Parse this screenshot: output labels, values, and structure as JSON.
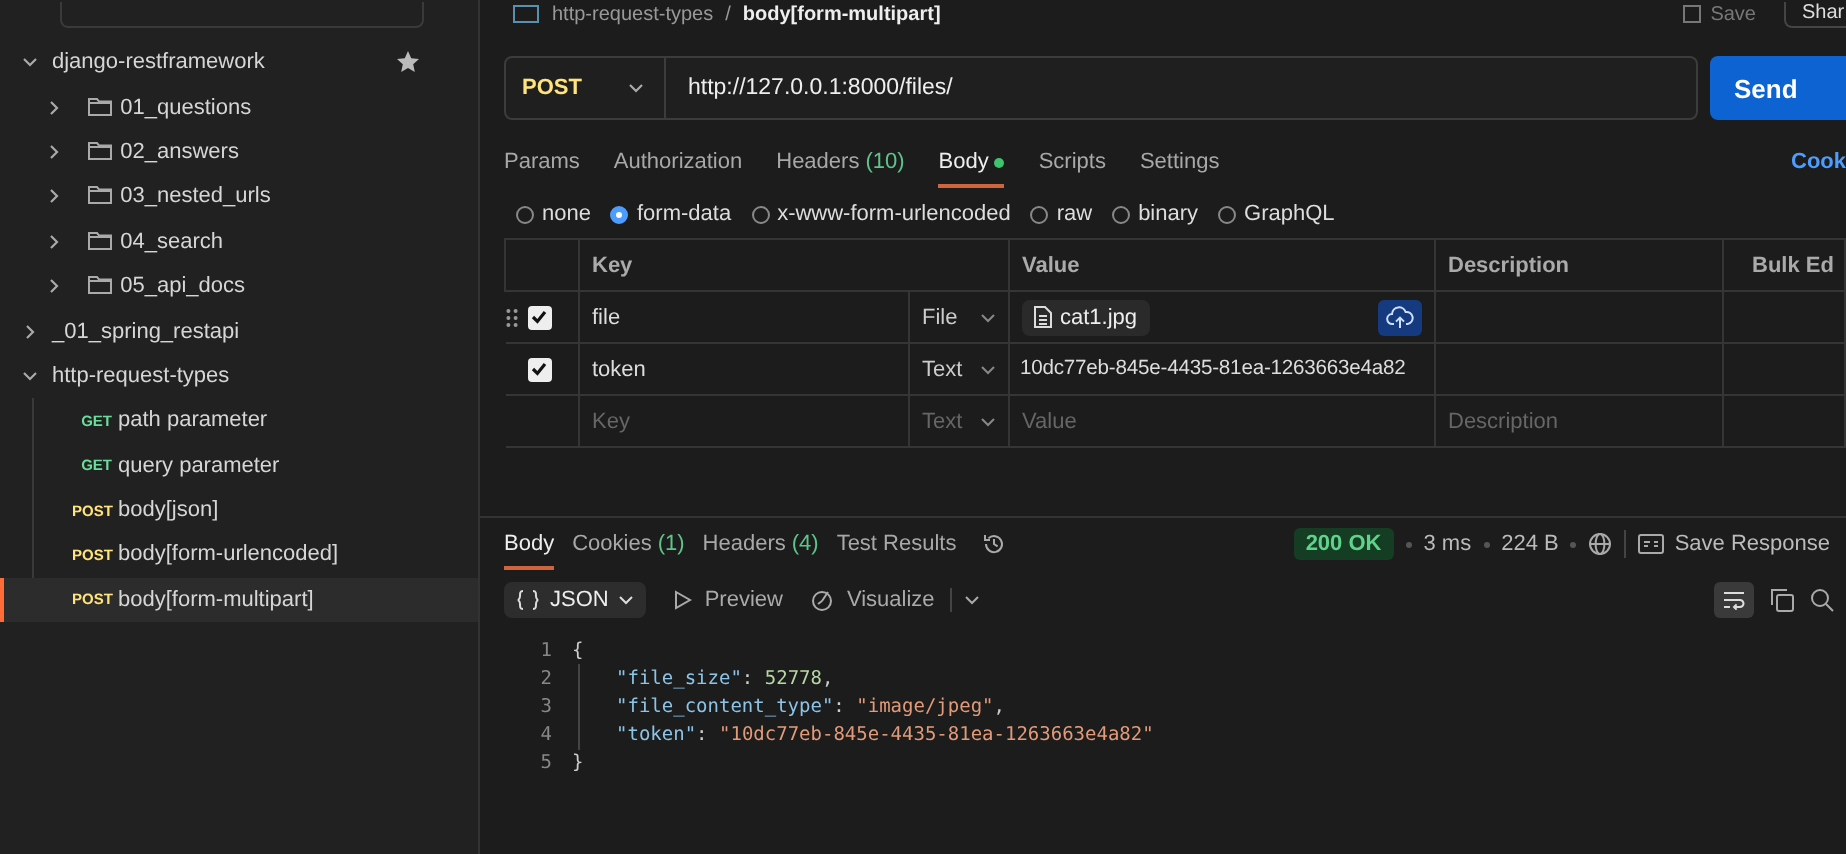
{
  "header": {
    "breadcrumb": [
      "http-request-types",
      "body[form-multipart]"
    ],
    "separator": "/",
    "save": "Save",
    "share": "Shar"
  },
  "sidebar": {
    "items": [
      {
        "label": "django-restframework",
        "kind": "collection",
        "expanded": true,
        "starred": true,
        "children": [
          {
            "label": "01_questions",
            "kind": "folder",
            "expanded": false
          },
          {
            "label": "02_answers",
            "kind": "folder",
            "expanded": false
          },
          {
            "label": "03_nested_urls",
            "kind": "folder",
            "expanded": false
          },
          {
            "label": "04_search",
            "kind": "folder",
            "expanded": false
          },
          {
            "label": "05_api_docs",
            "kind": "folder",
            "expanded": false
          }
        ]
      },
      {
        "label": "_01_spring_restapi",
        "kind": "collection",
        "expanded": false,
        "starred": false
      },
      {
        "label": "http-request-types",
        "kind": "collection",
        "expanded": true,
        "starred": false,
        "children": [
          {
            "label": "path parameter",
            "kind": "request",
            "method": "GET",
            "color": "#6bdd9a",
            "selected": false
          },
          {
            "label": "query parameter",
            "kind": "request",
            "method": "GET",
            "color": "#6bdd9a",
            "selected": false
          },
          {
            "label": "body[json]",
            "kind": "request",
            "method": "POST",
            "color": "#ffe47e",
            "selected": false
          },
          {
            "label": "body[form-urlencoded]",
            "kind": "request",
            "method": "POST",
            "color": "#ffe47e",
            "selected": false
          },
          {
            "label": "body[form-multipart]",
            "kind": "request",
            "method": "POST",
            "color": "#ffe47e",
            "selected": true
          }
        ]
      }
    ]
  },
  "request": {
    "method": {
      "label": "POST",
      "color": "#ffe47e"
    },
    "url": "http://127.0.0.1:8000/files/",
    "send": "Send",
    "tabs": [
      {
        "label": "Params",
        "selected": false
      },
      {
        "label": "Authorization",
        "selected": false
      },
      {
        "label": "Headers",
        "count": "(10)",
        "selected": false
      },
      {
        "label": "Body",
        "selected": true,
        "dot": true
      },
      {
        "label": "Scripts",
        "selected": false
      },
      {
        "label": "Settings",
        "selected": false
      }
    ],
    "cookies": "Cook",
    "body_types": [
      {
        "label": "none",
        "selected": false
      },
      {
        "label": "form-data",
        "selected": true
      },
      {
        "label": "x-www-form-urlencoded",
        "selected": false
      },
      {
        "label": "raw",
        "selected": false
      },
      {
        "label": "binary",
        "selected": false
      },
      {
        "label": "GraphQL",
        "selected": false
      }
    ],
    "table": {
      "columns": [
        "Key",
        "Value",
        "Description"
      ],
      "bulk_edit": "Bulk Ed",
      "rows": [
        {
          "key": "file",
          "checked": true,
          "type": "File",
          "kind": "file",
          "value": "cat1.jpg"
        },
        {
          "key": "token",
          "checked": true,
          "type": "Text",
          "kind": "text",
          "value": "10dc77eb-845e-4435-81ea-1263663e4a82"
        }
      ],
      "new_row": {
        "key": {
          "placeholder": "Key"
        },
        "type": "Text",
        "value": {
          "placeholder": "Value"
        },
        "description": {
          "placeholder": "Description"
        }
      }
    }
  },
  "response": {
    "tabs": [
      {
        "label": "Body",
        "selected": true
      },
      {
        "label": "Cookies",
        "count": "(1)",
        "selected": false
      },
      {
        "label": "Headers",
        "count": "(4)",
        "selected": false
      },
      {
        "label": "Test Results",
        "selected": false
      }
    ],
    "status": "200 OK",
    "time": "3 ms",
    "size": "224 B",
    "save": "Save Response",
    "format": "JSON",
    "preview": "Preview",
    "visualize": "Visualize",
    "lines": [
      {
        "number": "1",
        "tokens": [
          {
            "kind": "punct",
            "text": "{"
          }
        ]
      },
      {
        "number": "2",
        "tokens": [
          {
            "kind": "key",
            "text": "\"file_size\""
          },
          {
            "kind": "punct",
            "text": ": "
          },
          {
            "kind": "number",
            "text": "52778"
          },
          {
            "kind": "punct",
            "text": ","
          }
        ]
      },
      {
        "number": "3",
        "tokens": [
          {
            "kind": "key",
            "text": "\"file_content_type\""
          },
          {
            "kind": "punct",
            "text": ": "
          },
          {
            "kind": "string",
            "text": "\"image/jpeg\""
          },
          {
            "kind": "punct",
            "text": ","
          }
        ]
      },
      {
        "number": "4",
        "tokens": [
          {
            "kind": "key",
            "text": "\"token\""
          },
          {
            "kind": "punct",
            "text": ": "
          },
          {
            "kind": "string",
            "text": "\"10dc77eb-845e-4435-81ea-1263663e4a82\""
          }
        ]
      },
      {
        "number": "5",
        "tokens": [
          {
            "kind": "punct",
            "text": "}"
          }
        ]
      }
    ]
  }
}
